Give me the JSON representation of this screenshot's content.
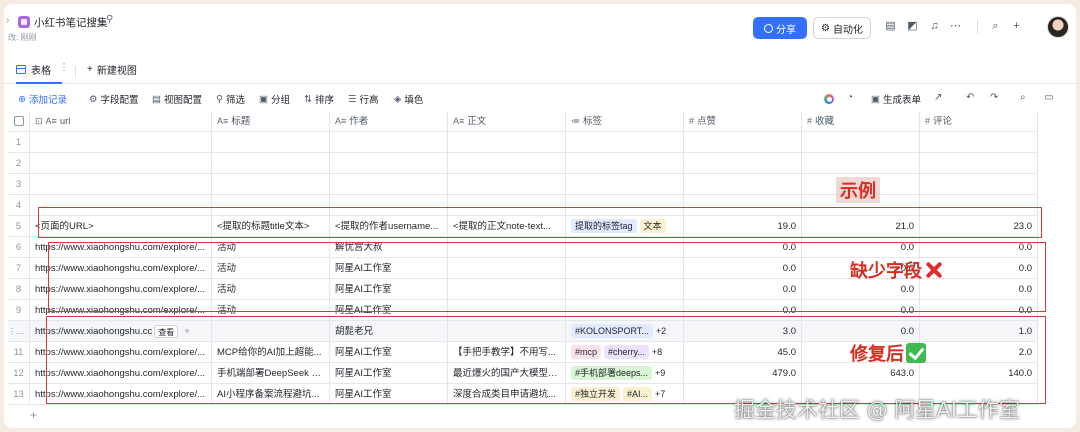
{
  "header": {
    "doc_title": "小红书笔记搜集",
    "doc_subtitle": "改: 刚刚",
    "share_label": "分享",
    "automation_label": "自动化"
  },
  "view_tabs": {
    "active": "表格",
    "new_view": "新建视图"
  },
  "toolbar": {
    "add_record": "添加记录",
    "field_config": "字段配置",
    "view_config": "视图配置",
    "filter": "筛选",
    "group": "分组",
    "sort": "排序",
    "row_height": "行高",
    "fill": "填色",
    "generate_form": "生成表单"
  },
  "columns": [
    {
      "icon": "A≡",
      "label": "url"
    },
    {
      "icon": "A≡",
      "label": "标题"
    },
    {
      "icon": "A≡",
      "label": "作者"
    },
    {
      "icon": "A≡",
      "label": "正文"
    },
    {
      "icon": "≔",
      "label": "标签"
    },
    {
      "icon": "#",
      "label": "点赞"
    },
    {
      "icon": "#",
      "label": "收藏"
    },
    {
      "icon": "#",
      "label": "评论"
    }
  ],
  "rows": [
    {
      "idx": "1",
      "url": "",
      "title": "",
      "author": "",
      "body": "",
      "tags": [],
      "extra": "",
      "likes": "",
      "favs": "",
      "comments": ""
    },
    {
      "idx": "2",
      "url": "",
      "title": "",
      "author": "",
      "body": "",
      "tags": [],
      "extra": "",
      "likes": "",
      "favs": "",
      "comments": ""
    },
    {
      "idx": "3",
      "url": "",
      "title": "",
      "author": "",
      "body": "",
      "tags": [],
      "extra": "",
      "likes": "",
      "favs": "",
      "comments": ""
    },
    {
      "idx": "4",
      "url": "",
      "title": "",
      "author": "",
      "body": "",
      "tags": [],
      "extra": "",
      "likes": "",
      "favs": "",
      "comments": ""
    },
    {
      "idx": "5",
      "url": "<页面的URL>",
      "title": "<提取的标题title文本>",
      "author": "<提取的作者username...",
      "body": "<提取的正文note-text...",
      "tags": [
        {
          "text": "提取的标签tag",
          "color": "blue"
        },
        {
          "text": "文本",
          "color": "yellow"
        }
      ],
      "extra": "",
      "likes": "19.0",
      "favs": "21.0",
      "comments": "23.0"
    },
    {
      "idx": "6",
      "url": "https://www.xiaohongshu.com/explore/...",
      "title": "活动",
      "author": "解忧宫大叔",
      "body": "",
      "tags": [],
      "extra": "",
      "likes": "0.0",
      "favs": "0.0",
      "comments": "0.0"
    },
    {
      "idx": "7",
      "url": "https://www.xiaohongshu.com/explore/...",
      "title": "活动",
      "author": "阿星AI工作室",
      "body": "",
      "tags": [],
      "extra": "",
      "likes": "0.0",
      "favs": "0.0",
      "comments": "0.0"
    },
    {
      "idx": "8",
      "url": "https://www.xiaohongshu.com/explore/...",
      "title": "活动",
      "author": "阿星AI工作室",
      "body": "",
      "tags": [],
      "extra": "",
      "likes": "0.0",
      "favs": "0.0",
      "comments": "0.0"
    },
    {
      "idx": "9",
      "url": "https://www.xiaohongshu.com/explore/...",
      "title": "活动",
      "author": "阿星AI工作室",
      "body": "",
      "tags": [],
      "extra": "",
      "likes": "0.0",
      "favs": "0.0",
      "comments": "0.0"
    },
    {
      "idx": "",
      "url": "https://www.xiaohongshu.cc",
      "title": "",
      "author": "胡髭老兄",
      "body": "",
      "tags": [
        {
          "text": "#KOLONSPORT...",
          "color": "blue"
        }
      ],
      "extra": "+2",
      "likes": "3.0",
      "favs": "0.0",
      "comments": "1.0",
      "hovered": true,
      "view_label": "查看"
    },
    {
      "idx": "11",
      "url": "https://www.xiaohongshu.com/explore/...",
      "title": "MCP给你的AI加上超能...",
      "author": "阿星AI工作室",
      "body": "【手把手教学】不用写...",
      "tags": [
        {
          "text": "#mcp",
          "color": "pink"
        },
        {
          "text": "#cherry...",
          "color": "purple"
        }
      ],
      "extra": "+8",
      "likes": "45.0",
      "favs": "",
      "comments": "2.0"
    },
    {
      "idx": "12",
      "url": "https://www.xiaohongshu.com/explore/...",
      "title": "手机端部署DeepSeek R...",
      "author": "阿星AI工作室",
      "body": "最近爆火的国产大模型D...",
      "tags": [
        {
          "text": "#手机部署deeps...",
          "color": "green"
        }
      ],
      "extra": "+9",
      "likes": "479.0",
      "favs": "643.0",
      "comments": "140.0"
    },
    {
      "idx": "13",
      "url": "https://www.xiaohongshu.com/explore/...",
      "title": "AI小程序备案流程避坑...",
      "author": "阿星AI工作室",
      "body": "深度合成类目申请避坑...",
      "tags": [
        {
          "text": "#独立开发",
          "color": "yellow"
        },
        {
          "text": "#AI...",
          "color": "yellow"
        }
      ],
      "extra": "+7",
      "likes": "",
      "favs": "",
      "comments": ""
    }
  ],
  "annotations": {
    "example": "示例",
    "missing": "缺少字段",
    "fixed": "修复后"
  },
  "watermark": "掘金技术社区 @ 阿星AI工作室"
}
